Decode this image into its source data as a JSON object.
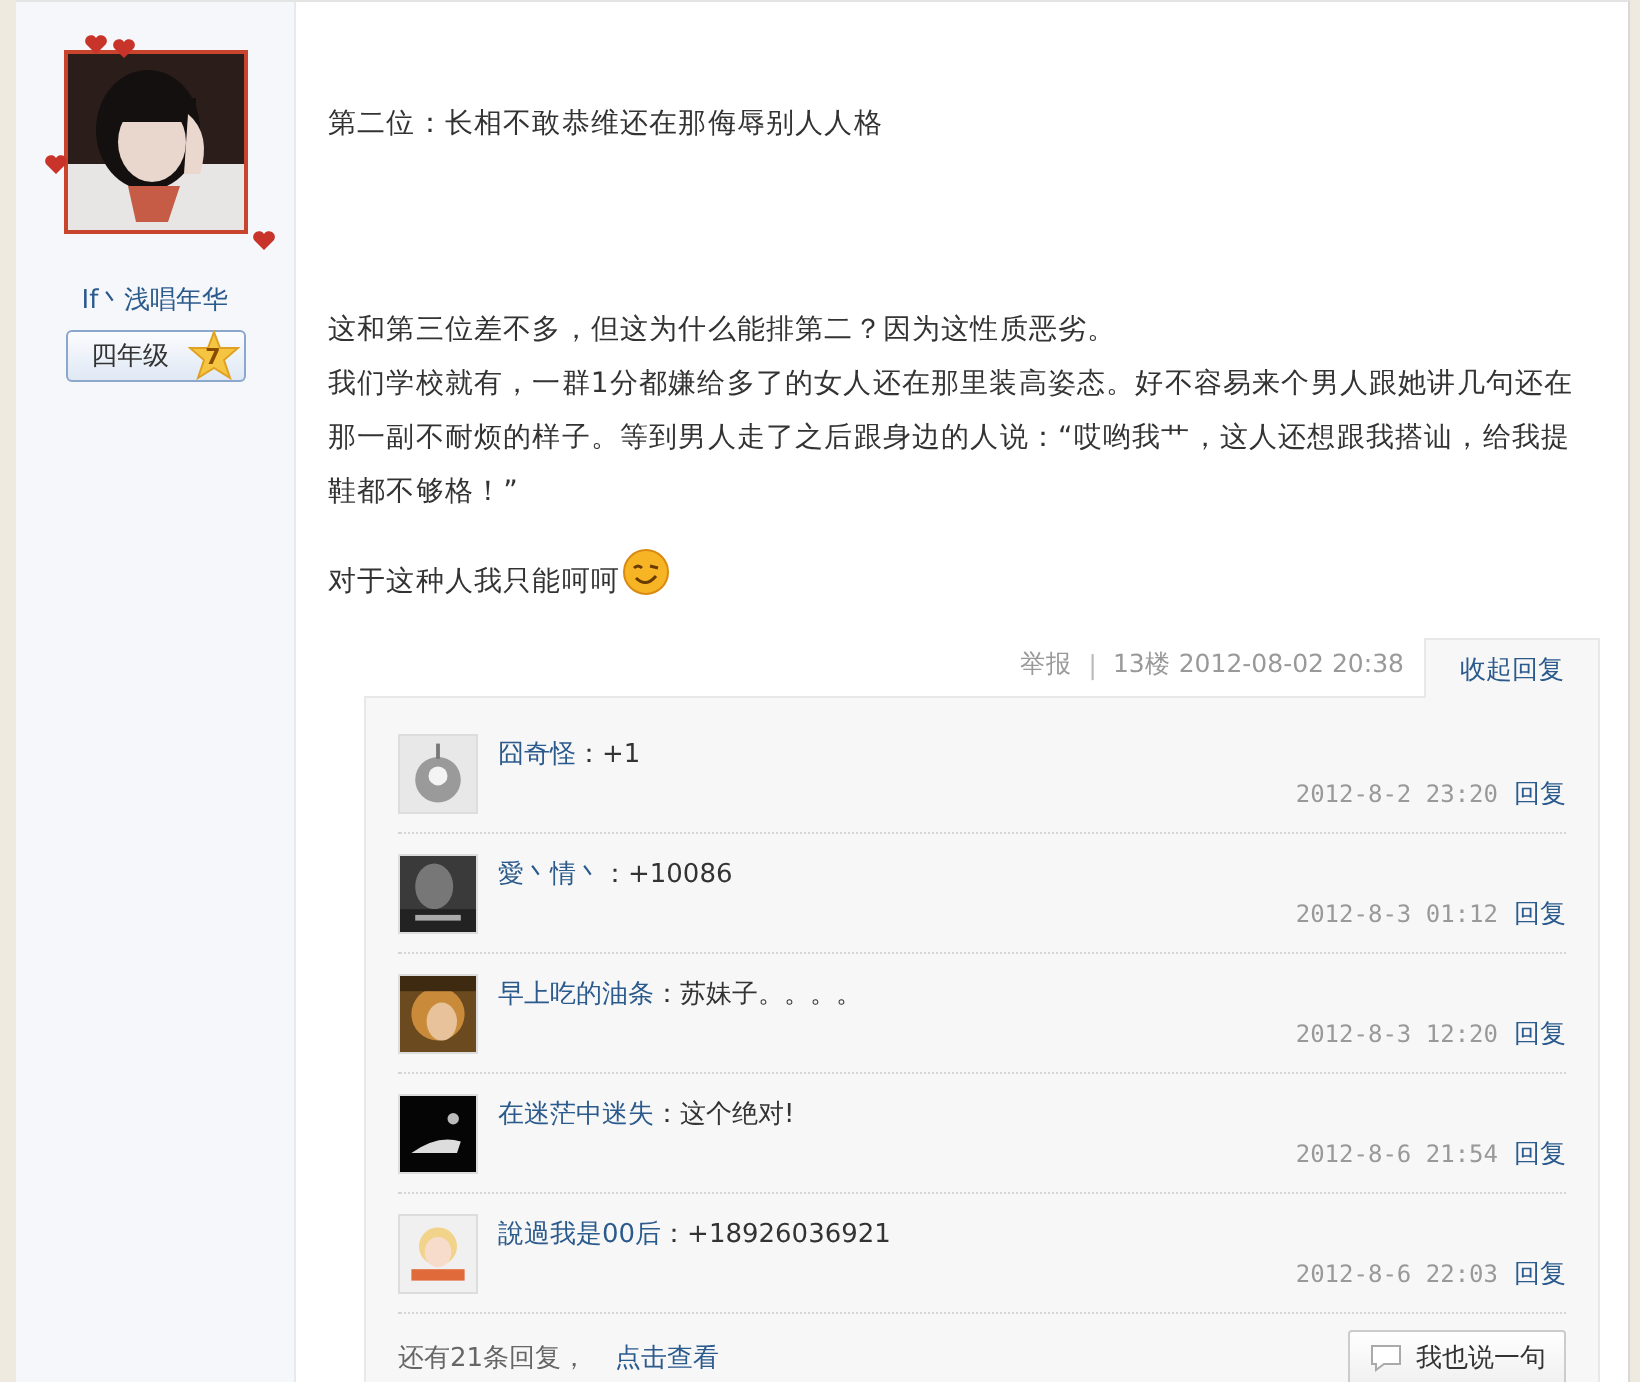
{
  "author": {
    "name": "If丶浅唱年华",
    "grade": "四年级",
    "level_badge": "7"
  },
  "post": {
    "blocks": [
      {
        "lines": [
          "第二位：长相不敢恭维还在那侮辱别人人格"
        ],
        "emoticon": false
      },
      {
        "lines": [
          "这和第三位差不多，但这为什么能排第二？因为这性质恶劣。",
          "我们学校就有，一群1分都嫌给多了的女人还在那里装高姿态。好不容易来个男人跟她讲几句还在那一副不耐烦的样子。等到男人走了之后跟身边的人说：“哎哟我艹，这人还想跟我搭讪，给我提鞋都不够格！”"
        ],
        "emoticon": false
      },
      {
        "lines": [
          "对于这种人我只能呵呵"
        ],
        "emoticon": true
      }
    ],
    "report": "举报",
    "separator": "|",
    "floor_info": "13楼 2012-08-02 20:38",
    "collapse_tab": "收起回复"
  },
  "replies": [
    {
      "name": "囧奇怪",
      "text": "：+1",
      "time": "2012-8-2 23:20",
      "reply": "回复"
    },
    {
      "name": "愛丶情丶",
      "text": "：+10086",
      "time": "2012-8-3 01:12",
      "reply": "回复"
    },
    {
      "name": "早上吃的油条",
      "text": "：苏妹子。。。。",
      "time": "2012-8-3 12:20",
      "reply": "回复"
    },
    {
      "name": "在迷茫中迷失",
      "text": "：这个绝对!",
      "time": "2012-8-6 21:54",
      "reply": "回复"
    },
    {
      "name": "說過我是00后",
      "text": "：+18926036921",
      "time": "2012-8-6 22:03",
      "reply": "回复"
    }
  ],
  "more": {
    "text": "还有21条回复，",
    "link": "点击查看",
    "button": "我也说一句"
  }
}
